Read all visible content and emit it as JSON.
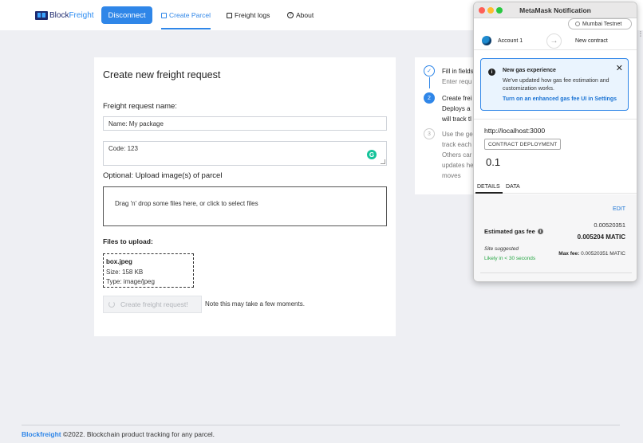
{
  "nav": {
    "logo_prefix": "Block",
    "logo_accent": "Freight",
    "disconnect": "Disconnect",
    "links": [
      "Create Parcel",
      "Freight logs",
      "About"
    ]
  },
  "form": {
    "title": "Create new freight request",
    "name_label": "Freight request name:",
    "name_value": "Name: My package",
    "code_value": "Code: 123",
    "upload_label": "Optional: Upload image(s) of parcel",
    "dropzone_text": "Drag 'n' drop some files here, or click to select files",
    "files_label": "Files to upload:",
    "file": {
      "name": "box.jpeg",
      "size": "Size: 158 KB",
      "type": "Type: image/jpeg"
    },
    "submit": "Create freight request!",
    "note": "Note this may take a few moments."
  },
  "steps": [
    {
      "num": "✓",
      "lines": [
        "Fill in fields",
        "Enter requ"
      ]
    },
    {
      "num": "2",
      "lines": [
        "Create frei",
        "Deploys a",
        "will track tl"
      ]
    },
    {
      "num": "3",
      "lines": [
        "Use the ge",
        "track each",
        "Others car",
        "updates he",
        "moves"
      ]
    }
  ],
  "footer": {
    "brand": "Blockfreight",
    "text": "©2022. Blockchain product tracking for any parcel."
  },
  "metamask": {
    "title": "MetaMask Notification",
    "network": "Mumbai Testnet",
    "account": "Account 1",
    "arrow": "→",
    "contract": "New contract",
    "banner": {
      "title": "New gas experience",
      "body": "We've updated how gas fee estimation and customization works.",
      "link": "Turn on an enhanced gas fee UI in Settings",
      "close": "✕"
    },
    "origin": "http://localhost:3000",
    "badge": "CONTRACT DEPLOYMENT",
    "amount": "0.1",
    "tabs": [
      "DETAILS",
      "DATA"
    ],
    "edit": "EDIT",
    "fee_small": "0.00520351",
    "fee_label": "Estimated gas fee",
    "fee_big": "0.005204 MATIC",
    "site_suggested": "Site suggested",
    "likely": "Likely in < 30 seconds",
    "max_fee_label": "Max fee:",
    "max_fee_value": "0.00520351 MATIC"
  },
  "colors": {
    "accent": "#2f86e8",
    "success": "#28a745",
    "grammarly": "#15c39a"
  }
}
